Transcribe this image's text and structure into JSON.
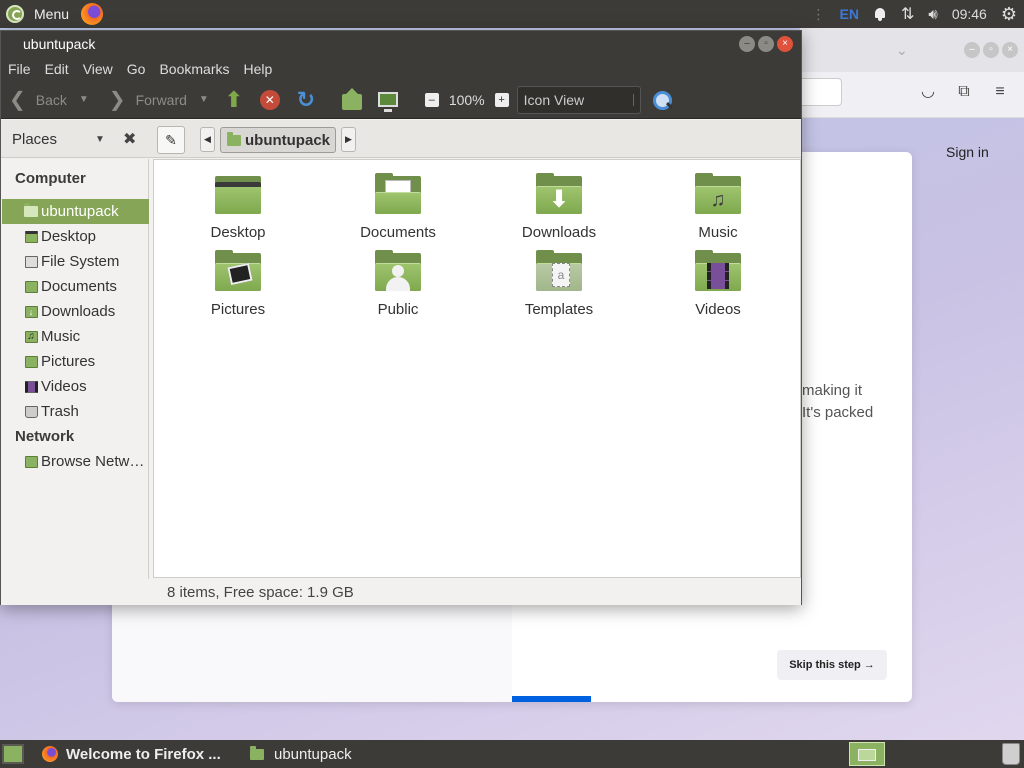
{
  "top_panel": {
    "menu_label": "Menu",
    "keyboard_layout": "EN",
    "clock": "09:46"
  },
  "firefox_bg": {
    "sign_in": "Sign in",
    "text_line1": "making it",
    "text_line2": "It's packed",
    "skip_button": "Skip this step →"
  },
  "file_manager": {
    "title": "ubuntupack",
    "menu": [
      "File",
      "Edit",
      "View",
      "Go",
      "Bookmarks",
      "Help"
    ],
    "toolbar": {
      "back": "Back",
      "forward": "Forward",
      "zoom": "100%",
      "view_mode": "Icon View"
    },
    "sidebar_selector": "Places",
    "breadcrumb": "ubuntupack",
    "sidebar": {
      "computer_heading": "Computer",
      "network_heading": "Network",
      "items": [
        {
          "label": "ubuntupack",
          "icon": "home-folder-icon"
        },
        {
          "label": "Desktop",
          "icon": "desktop-icon"
        },
        {
          "label": "File System",
          "icon": "drive-icon"
        },
        {
          "label": "Documents",
          "icon": "documents-icon"
        },
        {
          "label": "Downloads",
          "icon": "downloads-icon"
        },
        {
          "label": "Music",
          "icon": "music-icon"
        },
        {
          "label": "Pictures",
          "icon": "pictures-icon"
        },
        {
          "label": "Videos",
          "icon": "videos-icon"
        },
        {
          "label": "Trash",
          "icon": "trash-icon"
        }
      ],
      "network_items": [
        {
          "label": "Browse Network",
          "icon": "network-icon"
        }
      ]
    },
    "files": [
      {
        "name": "Desktop",
        "icon": "desktop-folder-icon"
      },
      {
        "name": "Documents",
        "icon": "documents-folder-icon"
      },
      {
        "name": "Downloads",
        "icon": "downloads-folder-icon"
      },
      {
        "name": "Music",
        "icon": "music-folder-icon"
      },
      {
        "name": "Pictures",
        "icon": "pictures-folder-icon"
      },
      {
        "name": "Public",
        "icon": "public-folder-icon"
      },
      {
        "name": "Templates",
        "icon": "templates-folder-icon"
      },
      {
        "name": "Videos",
        "icon": "videos-folder-icon"
      }
    ],
    "status": "8 items, Free space: 1.9 GB"
  },
  "taskbar": {
    "tasks": [
      {
        "label": "Welcome to Firefox ..."
      },
      {
        "label": "ubuntupack"
      }
    ]
  },
  "colors": {
    "accent": "#87a556",
    "panel": "#3c3b37"
  }
}
